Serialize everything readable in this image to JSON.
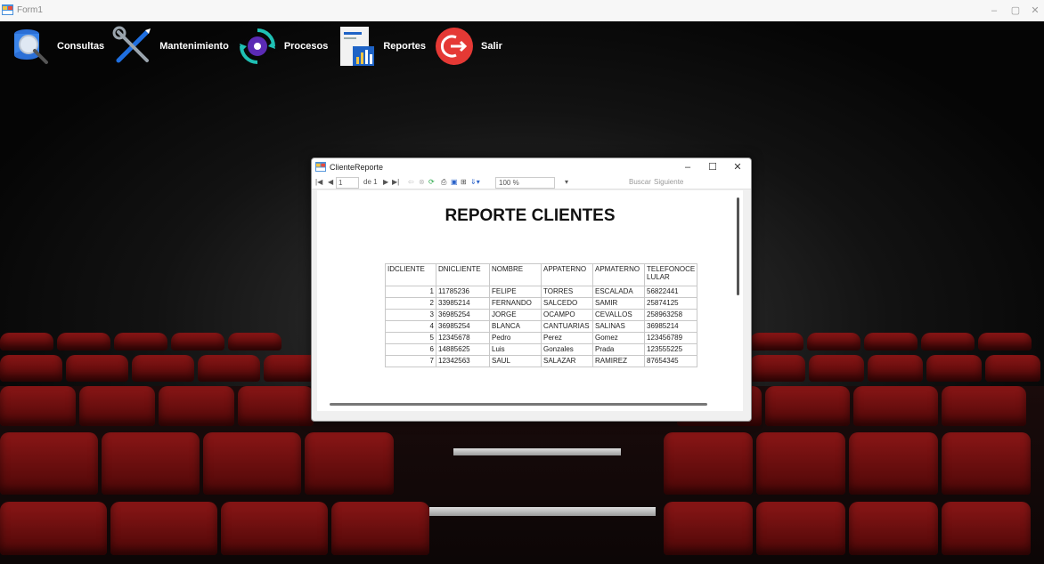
{
  "window": {
    "title": "Form1",
    "controls": [
      "–",
      "▢",
      "✕"
    ]
  },
  "menu": [
    {
      "label": "Consultas",
      "icon": "database-search-icon"
    },
    {
      "label": "Mantenimiento",
      "icon": "tools-icon"
    },
    {
      "label": "Procesos",
      "icon": "gear-process-icon"
    },
    {
      "label": "Reportes",
      "icon": "report-chart-icon"
    },
    {
      "label": "Salir",
      "icon": "exit-icon"
    }
  ],
  "report_window": {
    "title": "ClienteReporte",
    "controls": [
      "–",
      "☐",
      "✕"
    ],
    "toolbar": {
      "page_current": "1",
      "page_of": "de 1",
      "zoom": "100 %",
      "search_label": "Buscar",
      "next_label": "Siguiente"
    },
    "report": {
      "title": "REPORTE CLIENTES",
      "columns": [
        "IDCLIENTE",
        "DNICLIENTE",
        "NOMBRE",
        "APPATERNO",
        "APMATERNO",
        "TELEFONOCE LULAR"
      ],
      "rows": [
        [
          "1",
          "11785236",
          "FELIPE",
          "TORRES",
          "ESCALADA",
          "56822441"
        ],
        [
          "2",
          "33985214",
          "FERNANDO",
          "SALCEDO",
          "SAMIR",
          "25874125"
        ],
        [
          "3",
          "36985254",
          "JORGE",
          "OCAMPO",
          "CEVALLOS",
          "258963258"
        ],
        [
          "4",
          "36985254",
          "BLANCA",
          "CANTUARIAS",
          "SALINAS",
          "36985214"
        ],
        [
          "5",
          "12345678",
          "Pedro",
          "Perez",
          "Gomez",
          "123456789"
        ],
        [
          "6",
          "14885625",
          "Luis",
          "Gonzales",
          "Prada",
          "123555225"
        ],
        [
          "7",
          "12342563",
          "SAUL",
          "SALAZAR",
          "RAMIREZ",
          "87654345"
        ]
      ]
    }
  },
  "colors": {
    "accent_red": "#e53935",
    "report_icon_blue": "#1e63c6",
    "process_teal": "#1fc0b4",
    "process_purple": "#5b2bb5"
  }
}
